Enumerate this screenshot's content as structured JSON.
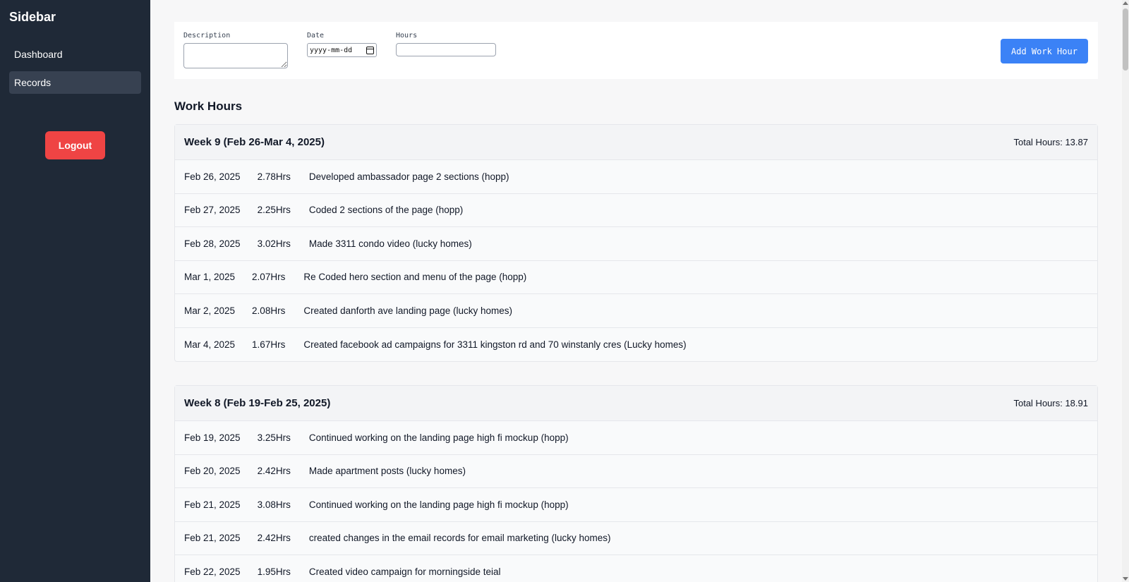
{
  "sidebar": {
    "title": "Sidebar",
    "items": [
      {
        "label": "Dashboard",
        "active": false
      },
      {
        "label": "Records",
        "active": true
      }
    ],
    "logout_label": "Logout"
  },
  "form": {
    "description_label": "Description",
    "description_value": "",
    "date_label": "Date",
    "date_placeholder": "yyyy-mm-dd",
    "hours_label": "Hours",
    "hours_value": "",
    "submit_label": "Add Work Hour"
  },
  "colors": {
    "sidebar_bg": "#1f2937",
    "logout": "#ef4444",
    "primary": "#3b82f6"
  },
  "section_title": "Work Hours",
  "weeks": [
    {
      "title": "Week 9 (Feb 26-Mar 4, 2025)",
      "total": "Total Hours: 13.87",
      "entries": [
        {
          "date": "Feb 26, 2025",
          "hours": "2.78Hrs",
          "description": "Developed ambassador page 2 sections (hopp)"
        },
        {
          "date": "Feb 27, 2025",
          "hours": "2.25Hrs",
          "description": "Coded 2 sections of the page (hopp)"
        },
        {
          "date": "Feb 28, 2025",
          "hours": "3.02Hrs",
          "description": "Made 3311 condo video (lucky homes)"
        },
        {
          "date": "Mar 1, 2025",
          "hours": "2.07Hrs",
          "description": "Re Coded hero section and menu of the page (hopp)"
        },
        {
          "date": "Mar 2, 2025",
          "hours": "2.08Hrs",
          "description": "Created danforth ave landing page (lucky homes)"
        },
        {
          "date": "Mar 4, 2025",
          "hours": "1.67Hrs",
          "description": "Created facebook ad campaigns for 3311 kingston rd and 70 winstanly cres (Lucky homes)"
        }
      ]
    },
    {
      "title": "Week 8 (Feb 19-Feb 25, 2025)",
      "total": "Total Hours: 18.91",
      "entries": [
        {
          "date": "Feb 19, 2025",
          "hours": "3.25Hrs",
          "description": "Continued working on the landing page high fi mockup (hopp)"
        },
        {
          "date": "Feb 20, 2025",
          "hours": "2.42Hrs",
          "description": "Made apartment posts (lucky homes)"
        },
        {
          "date": "Feb 21, 2025",
          "hours": "3.08Hrs",
          "description": "Continued working on the landing page high fi mockup (hopp)"
        },
        {
          "date": "Feb 21, 2025",
          "hours": "2.42Hrs",
          "description": "created changes in the email records for email marketing (lucky homes)"
        },
        {
          "date": "Feb 22, 2025",
          "hours": "1.95Hrs",
          "description": "Created video campaign for morningside teial"
        }
      ]
    }
  ]
}
